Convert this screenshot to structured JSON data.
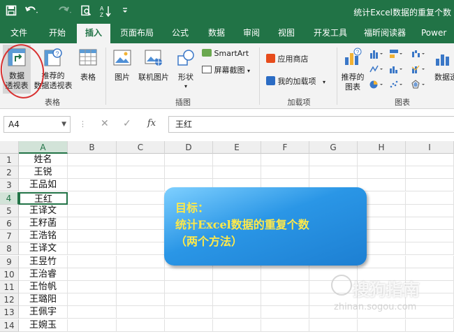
{
  "titlebar": {
    "title": "统计Excel数据的重复个数",
    "save_icon": "save-icon",
    "undo_icon": "undo-icon",
    "redo_icon": "redo-icon",
    "preview_icon": "print-preview-icon",
    "sort_icon": "sort-az-icon",
    "customize_icon": "customize-qat-icon"
  },
  "tabs": [
    "文件",
    "开始",
    "插入",
    "页面布局",
    "公式",
    "数据",
    "审阅",
    "视图",
    "开发工具",
    "福昕阅读器",
    "Power P"
  ],
  "active_tab": "插入",
  "ribbon": {
    "tables": {
      "pivot": "数据\n透视表",
      "pivot_l1": "数据",
      "pivot_l2": "透视表",
      "rec_pivot_l1": "推荐的",
      "rec_pivot_l2": "数据透视表",
      "table": "表格",
      "group": "表格"
    },
    "illustrations": {
      "picture": "图片",
      "online_picture": "联机图片",
      "shapes": "形状",
      "smartart": "SmartArt",
      "screenshot": "屏幕截图",
      "group": "插图"
    },
    "addins": {
      "store": "应用商店",
      "my_addins": "我的加载项",
      "group": "加载项"
    },
    "charts": {
      "recommended_l1": "推荐的",
      "recommended_l2": "图表",
      "pivotchart": "数据透",
      "group": "图表"
    }
  },
  "formula_bar": {
    "name_box": "A4",
    "cancel": "✕",
    "enter": "✓",
    "fx": "fx",
    "value": "王红"
  },
  "columns": [
    "A",
    "B",
    "C",
    "D",
    "E",
    "F",
    "G",
    "H",
    "I"
  ],
  "active_column": "A",
  "rows": [
    {
      "num": "1",
      "a": "姓名"
    },
    {
      "num": "2",
      "a": "王锐"
    },
    {
      "num": "3",
      "a": "王品如"
    },
    {
      "num": "4",
      "a": "王红"
    },
    {
      "num": "5",
      "a": "王译文"
    },
    {
      "num": "6",
      "a": "王籽菡"
    },
    {
      "num": "7",
      "a": "王浩铭"
    },
    {
      "num": "8",
      "a": "王译文"
    },
    {
      "num": "9",
      "a": "王昱竹"
    },
    {
      "num": "10",
      "a": "王治睿"
    },
    {
      "num": "11",
      "a": "王怡帆"
    },
    {
      "num": "12",
      "a": "王璐阳"
    },
    {
      "num": "13",
      "a": "王佩宇"
    },
    {
      "num": "14",
      "a": "王婉玉"
    }
  ],
  "active_row": "4",
  "callout": {
    "line1": "目标：",
    "line2": "统计Excel数据的重复个数",
    "line3": "（两个方法）"
  },
  "watermark": {
    "text": "搜狗指南",
    "url": "zhinan.sogou.com"
  },
  "colors": {
    "excel_green": "#217346",
    "callout_blue": "#2a96e6",
    "callout_text": "#ffe94a",
    "annotation_red": "#d83030"
  }
}
